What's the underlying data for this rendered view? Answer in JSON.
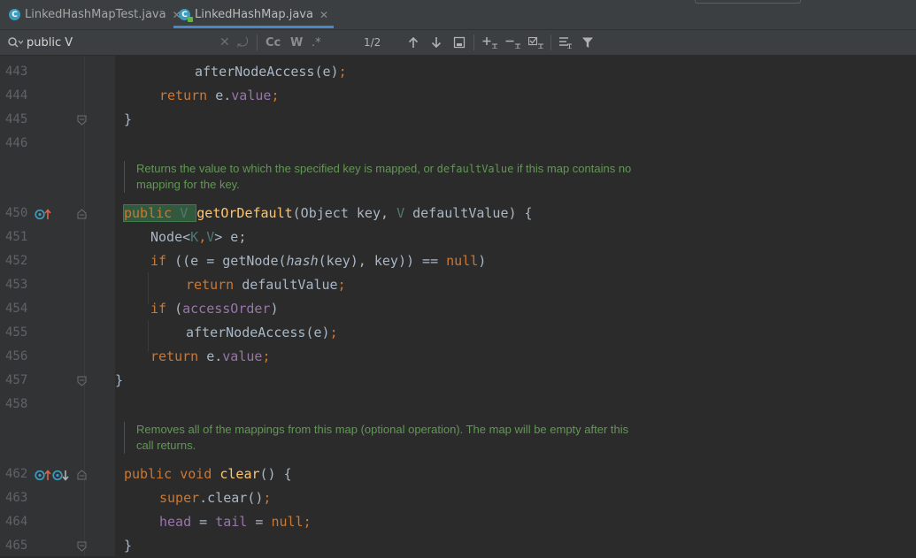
{
  "tabs": [
    {
      "label": "LinkedHashMapTest.java",
      "close": "✕"
    },
    {
      "label": "LinkedHashMap.java",
      "close": "✕"
    }
  ],
  "search": {
    "query": "public V",
    "match_case": "Cc",
    "words": "W",
    "regex": ".*",
    "count": "1/2"
  },
  "gutter": {
    "l443": "443",
    "l444": "444",
    "l445": "445",
    "l446": "446",
    "l450": "450",
    "l451": "451",
    "l452": "452",
    "l453": "453",
    "l454": "454",
    "l455": "455",
    "l456": "456",
    "l457": "457",
    "l458": "458",
    "l462": "462",
    "l463": "463",
    "l464": "464",
    "l465": "465"
  },
  "code": {
    "c443": "afterNodeAccess(e)",
    "c444_kw": "return",
    "c444_a": "e.",
    "c444_field": "value",
    "brace_close": "}",
    "c450_public": "public",
    "c450_v": "V",
    "c450_fn": "getOrDefault",
    "c450_a": "(Object key,",
    "c450_v2": "V",
    "c450_b": "defaultValue) {",
    "c451_a": "Node<",
    "c451_k": "K",
    "c451_comma": ",",
    "c451_v": "V",
    "c451_b": "> e;",
    "c452_if": "if",
    "c452_a": "((e = getNode(",
    "c452_hash": "hash",
    "c452_b": "(key), key)) ==",
    "c452_null": "null",
    "c452_c": ")",
    "c453_ret": "return",
    "c453_a": "defaultValue",
    "c454_if": "if",
    "c454_a": "(",
    "c454_fld": "accessOrder",
    "c454_b": ")",
    "c455": "afterNodeAccess(e)",
    "c456_ret": "return",
    "c456_a": "e.",
    "c456_fld": "value",
    "c462_public": "public",
    "c462_void": "void",
    "c462_fn": "clear",
    "c462_a": "() {",
    "c463_super": "super",
    "c463_a": ".clear()",
    "c464_head": "head",
    "c464_eq": "=",
    "c464_tail": "tail",
    "c464_null": "null",
    "semi": ";"
  },
  "docs": {
    "d1_a": "Returns the value to which the specified key is mapped, or ",
    "d1_code": "defaultValue",
    "d1_b": " if this map contains no",
    "d1_c": "mapping for the key.",
    "d2_a": "Removes all of the mappings from this map (optional operation). The map will be empty after this",
    "d2_b": "call returns."
  },
  "colors": {
    "keyword": "#cc7832",
    "method": "#ffc66d",
    "field": "#9876aa",
    "doc": "#629755",
    "background": "#2b2b2b"
  }
}
